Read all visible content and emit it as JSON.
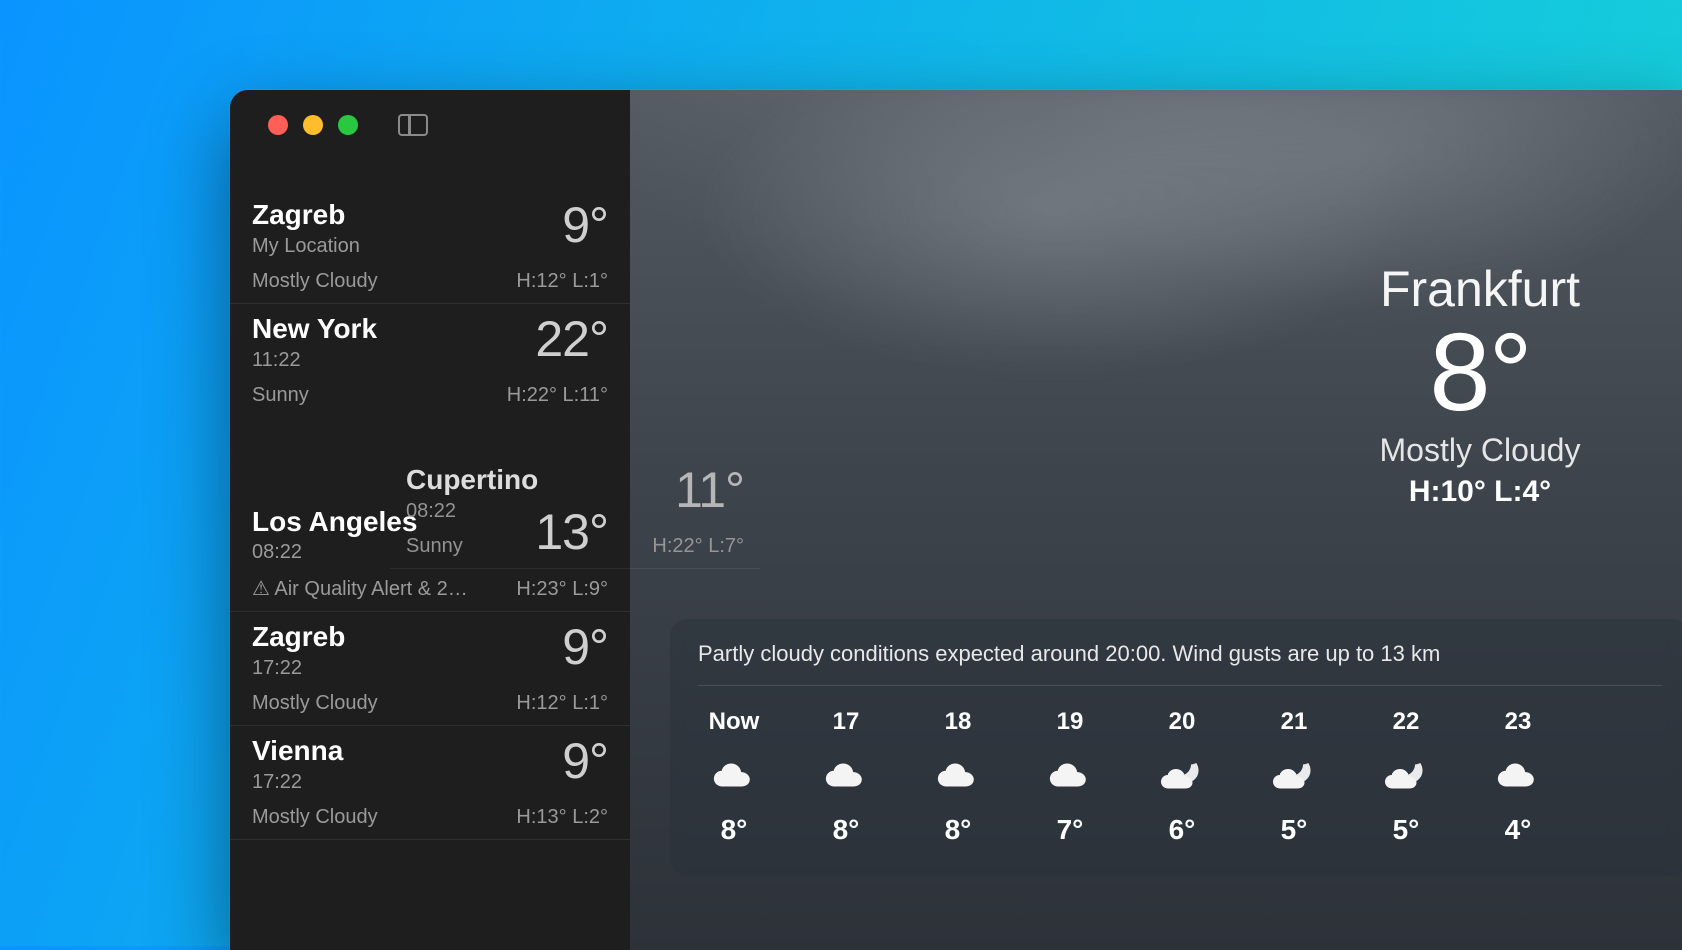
{
  "sidebar": {
    "locations": [
      {
        "name": "Zagreb",
        "sub": "My Location",
        "temp": "9°",
        "cond": "Mostly Cloudy",
        "hilo": "H:12°  L:1°"
      },
      {
        "name": "New York",
        "sub": "11:22",
        "temp": "22°",
        "cond": "Sunny",
        "hilo": "H:22°  L:11°"
      },
      {
        "name": "Los Angeles",
        "sub": "08:22",
        "temp": "13°",
        "cond": "⚠ Air Quality Alert & 2…",
        "hilo": "H:23°  L:9°"
      },
      {
        "name": "Zagreb",
        "sub": "17:22",
        "temp": "9°",
        "cond": "Mostly Cloudy",
        "hilo": "H:12°  L:1°"
      },
      {
        "name": "Vienna",
        "sub": "17:22",
        "temp": "9°",
        "cond": "Mostly Cloudy",
        "hilo": "H:13°  L:2°"
      }
    ],
    "dragged": {
      "name": "Cupertino",
      "sub": "08:22",
      "temp": "11°",
      "cond": "Sunny",
      "hilo": "H:22°  L:7°"
    }
  },
  "main": {
    "city": "Frankfurt",
    "temp": "8°",
    "cond": "Mostly Cloudy",
    "hilo": "H:10°  L:4°",
    "forecast_desc": "Partly cloudy conditions expected around 20:00. Wind gusts are up to 13 km",
    "hours": [
      {
        "time": "Now",
        "icon": "cloud",
        "temp": "8°"
      },
      {
        "time": "17",
        "icon": "cloud",
        "temp": "8°"
      },
      {
        "time": "18",
        "icon": "cloud",
        "temp": "8°"
      },
      {
        "time": "19",
        "icon": "cloud",
        "temp": "7°"
      },
      {
        "time": "20",
        "icon": "night-cloud",
        "temp": "6°"
      },
      {
        "time": "21",
        "icon": "night-cloud",
        "temp": "5°"
      },
      {
        "time": "22",
        "icon": "night-cloud",
        "temp": "5°"
      },
      {
        "time": "23",
        "icon": "cloud",
        "temp": "4°"
      }
    ]
  }
}
